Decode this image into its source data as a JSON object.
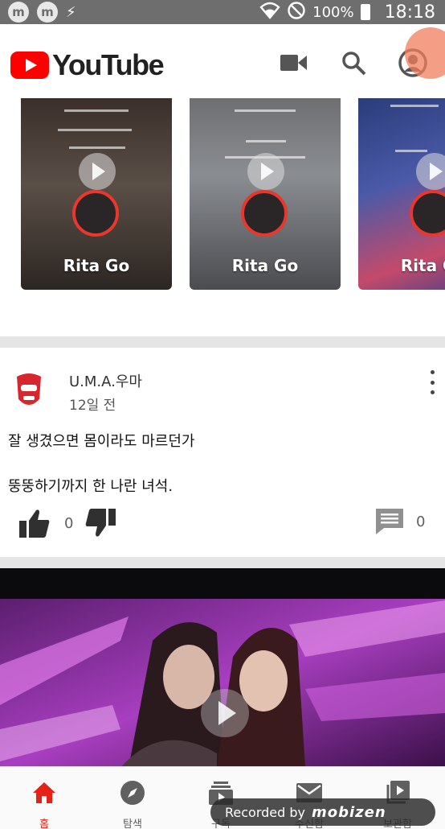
{
  "status_bar": {
    "left_icons": [
      "m",
      "m"
    ],
    "battery": "100%",
    "time": "18:18"
  },
  "app_bar": {
    "logo_text": "YouTube",
    "icons": [
      "video-camera-icon",
      "search-icon",
      "account-icon"
    ]
  },
  "shorts": [
    {
      "title": "Rita Go"
    },
    {
      "title": "Rita Go"
    },
    {
      "title": "Rita Go"
    }
  ],
  "post": {
    "author": "U.M.A.우마",
    "date": "12일 전",
    "lines": [
      "잘 생겼으면 몸이라도 마르던가",
      "뚱뚱하기까지 한 나란 녀석."
    ],
    "likes": "0",
    "comments": "0"
  },
  "bottom_nav": {
    "items": [
      {
        "label": "홈",
        "icon": "home-icon",
        "active": true
      },
      {
        "label": "탐색",
        "icon": "compass-icon",
        "active": false
      },
      {
        "label": "구독",
        "icon": "subscriptions-icon",
        "active": false
      },
      {
        "label": "수신함",
        "icon": "inbox-icon",
        "active": false
      },
      {
        "label": "보관함",
        "icon": "library-icon",
        "active": false
      }
    ]
  },
  "recorder": {
    "text": "Recorded by",
    "brand": "mobizen"
  },
  "colors": {
    "brand_red": "#ff0000",
    "active_red": "#e62117",
    "status_bar": "#6e6e6e"
  }
}
